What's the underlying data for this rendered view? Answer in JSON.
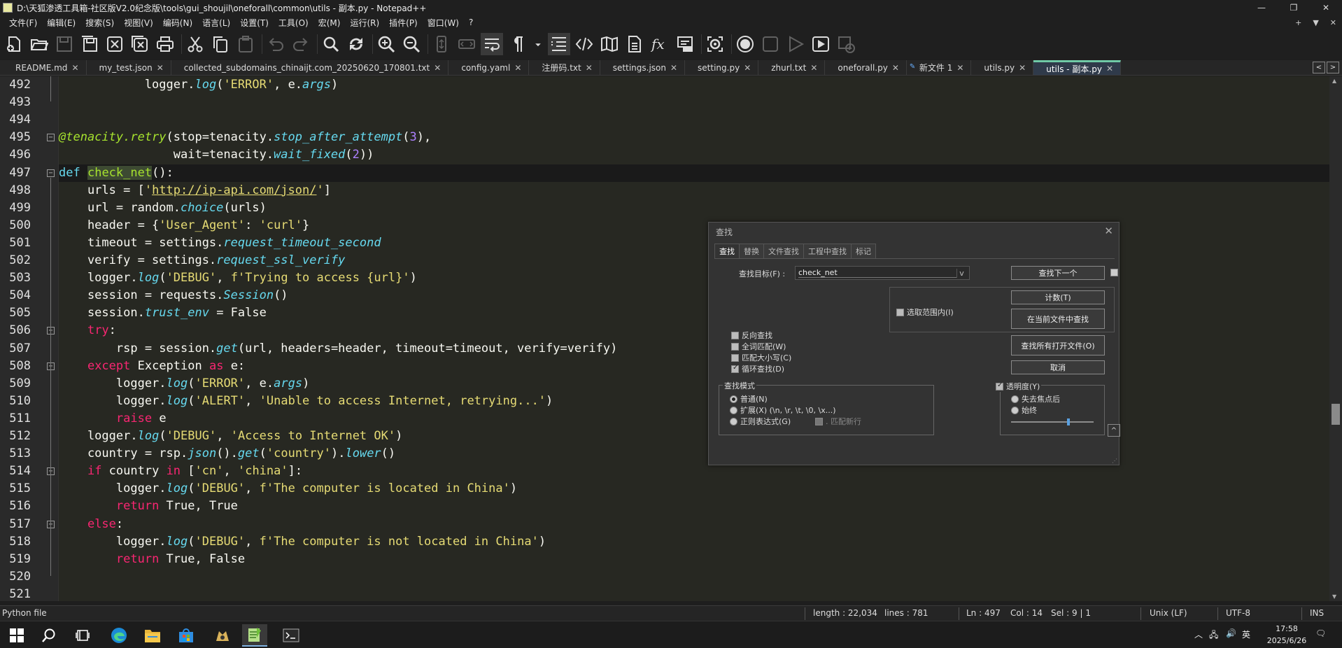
{
  "window": {
    "title": "D:\\天狐渗透工具箱-社区版V2.0纪念版\\tools\\gui_shoujil\\oneforall\\common\\utils - 副本.py - Notepad++",
    "minimize": "—",
    "maximize": "❐",
    "close": "✕"
  },
  "menu": {
    "items": [
      "文件(F)",
      "编辑(E)",
      "搜索(S)",
      "视图(V)",
      "编码(N)",
      "语言(L)",
      "设置(T)",
      "工具(O)",
      "宏(M)",
      "运行(R)",
      "插件(P)",
      "窗口(W)",
      "?"
    ],
    "right": [
      "+",
      "▼",
      "✕"
    ]
  },
  "tabs": [
    {
      "label": "README.md",
      "active": false,
      "new": false
    },
    {
      "label": "my_test.json",
      "active": false,
      "new": false
    },
    {
      "label": "collected_subdomains_chinaijt.com_20250620_170801.txt",
      "active": false,
      "new": false
    },
    {
      "label": "config.yaml",
      "active": false,
      "new": false
    },
    {
      "label": "注册码.txt",
      "active": false,
      "new": false
    },
    {
      "label": "settings.json",
      "active": false,
      "new": false
    },
    {
      "label": "setting.py",
      "active": false,
      "new": false
    },
    {
      "label": "zhurl.txt",
      "active": false,
      "new": false
    },
    {
      "label": "oneforall.py",
      "active": false,
      "new": false
    },
    {
      "label": "新文件 1",
      "active": false,
      "new": true
    },
    {
      "label": "utils.py",
      "active": false,
      "new": false
    },
    {
      "label": "utils - 副本.py",
      "active": true,
      "new": false
    }
  ],
  "tab_close": "✕",
  "tab_nav": [
    "<",
    ">"
  ],
  "code": {
    "lines": [
      {
        "n": "492",
        "html": "            logger.<span class='it'>log</span>(<span class='st'>'ERROR'</span>, e.<span class='it'>args</span>)"
      },
      {
        "n": "493",
        "html": ""
      },
      {
        "n": "494",
        "html": ""
      },
      {
        "n": "495",
        "html": "<span class='dec'>@tenacity.retry</span>(stop=tenacity.<span class='it'>stop_after_attempt</span>(<span class='num'>3</span>),"
      },
      {
        "n": "496",
        "html": "                wait=tenacity.<span class='it'>wait_fixed</span>(<span class='num'>2</span>))"
      },
      {
        "n": "497",
        "html": "<span class='kw'>def</span> <span class='fn hl'>check_net</span>():"
      },
      {
        "n": "498",
        "html": "    urls = [<span class='st'>'</span><span class='url'>http://ip-api.com/json/</span><span class='st'>'</span>]"
      },
      {
        "n": "499",
        "html": "    url = random.<span class='it'>choice</span>(urls)"
      },
      {
        "n": "500",
        "html": "    header = {<span class='st'>'User_Agent'</span>: <span class='st'>'curl'</span>}"
      },
      {
        "n": "501",
        "html": "    timeout = settings.<span class='it'>request_timeout_second</span>"
      },
      {
        "n": "502",
        "html": "    verify = settings.<span class='it'>request_ssl_verify</span>"
      },
      {
        "n": "503",
        "html": "    logger.<span class='it'>log</span>(<span class='st'>'DEBUG'</span>, <span class='st'>f'Trying to access {url}'</span>)"
      },
      {
        "n": "504",
        "html": "    session = requests.<span class='it'>Session</span>()"
      },
      {
        "n": "505",
        "html": "    session.<span class='it'>trust_env</span> = False"
      },
      {
        "n": "506",
        "html": "    <span class='kw2'>try</span>:"
      },
      {
        "n": "507",
        "html": "        rsp = session.<span class='it'>get</span>(url, headers=header, timeout=timeout, verify=verify)"
      },
      {
        "n": "508",
        "html": "    <span class='kw2'>except</span> Exception <span class='kw2'>as</span> e:"
      },
      {
        "n": "509",
        "html": "        logger.<span class='it'>log</span>(<span class='st'>'ERROR'</span>, e.<span class='it'>args</span>)"
      },
      {
        "n": "510",
        "html": "        logger.<span class='it'>log</span>(<span class='st'>'ALERT'</span>, <span class='st'>'Unable to access Internet, retrying...'</span>)"
      },
      {
        "n": "511",
        "html": "        <span class='kw2'>raise</span> e"
      },
      {
        "n": "512",
        "html": "    logger.<span class='it'>log</span>(<span class='st'>'DEBUG'</span>, <span class='st'>'Access to Internet OK'</span>)"
      },
      {
        "n": "513",
        "html": "    country = rsp.<span class='it'>json</span>().<span class='it'>get</span>(<span class='st'>'country'</span>).<span class='it'>lower</span>()"
      },
      {
        "n": "514",
        "html": "    <span class='kw2'>if</span> country <span class='kw2'>in</span> [<span class='st'>'cn'</span>, <span class='st'>'china'</span>]:"
      },
      {
        "n": "515",
        "html": "        logger.<span class='it'>log</span>(<span class='st'>'DEBUG'</span>, <span class='st'>f'The computer is located in China'</span>)"
      },
      {
        "n": "516",
        "html": "        <span class='kw2'>return</span> True, True"
      },
      {
        "n": "517",
        "html": "    <span class='kw2'>else</span>:"
      },
      {
        "n": "518",
        "html": "        logger.<span class='it'>log</span>(<span class='st'>'DEBUG'</span>, <span class='st'>f'The computer is not located in China'</span>)"
      },
      {
        "n": "519",
        "html": "        <span class='kw2'>return</span> True, False"
      },
      {
        "n": "520",
        "html": ""
      },
      {
        "n": "521",
        "html": ""
      }
    ],
    "current_line": "497",
    "fold_open_lines": [
      "495",
      "497",
      "506",
      "508",
      "514",
      "517"
    ]
  },
  "find": {
    "title": "查找",
    "close": "✕",
    "tabs": [
      "查找",
      "替换",
      "文件查找",
      "工程中查找",
      "标记"
    ],
    "active_tab": "查找",
    "target_label": "查找目标(F) :",
    "target_value": "check_net",
    "dropdown": "v",
    "buttons": {
      "find_next": "查找下一个",
      "count": "计数(T)",
      "find_in_current": "在当前文件中查找",
      "find_in_all_open": "查找所有打开文件(O)",
      "cancel": "取消"
    },
    "in_selection": {
      "label": "选取范围内(I)",
      "checked": false
    },
    "options": [
      {
        "label": "反向查找",
        "checked": false
      },
      {
        "label": "全词匹配(W)",
        "checked": false
      },
      {
        "label": "匹配大小写(C)",
        "checked": false
      },
      {
        "label": "循环查找(D)",
        "checked": true
      }
    ],
    "mode": {
      "title": "查找模式",
      "options": [
        {
          "label": "普通(N)",
          "selected": true
        },
        {
          "label": "扩展(X) (\\n, \\r, \\t, \\0, \\x...)",
          "selected": false
        },
        {
          "label": "正则表达式(G)",
          "selected": false
        }
      ],
      "dot_newline": ". 匹配新行"
    },
    "transparency": {
      "label": "透明度(Y)",
      "checked": true,
      "options": [
        {
          "label": "失去焦点后",
          "selected": false
        },
        {
          "label": "始终",
          "selected": false
        }
      ],
      "level": 0.7
    },
    "collapse": "^"
  },
  "status": {
    "language": "Python file",
    "length": "length : 22,034",
    "lines": "lines : 781",
    "ln": "Ln : 497",
    "col": "Col : 14",
    "sel": "Sel : 9 | 1",
    "eol": "Unix (LF)",
    "encoding": "UTF-8",
    "mode": "INS"
  },
  "taskbar": {
    "ime": "英",
    "time": "17:58",
    "date": "2025/6/26"
  },
  "colors": {
    "editor_bg": "#272822",
    "active_tab_accent": "#6fc9a6",
    "keyword": "#66d9ef",
    "string": "#e6db74",
    "number": "#ae81ff"
  }
}
